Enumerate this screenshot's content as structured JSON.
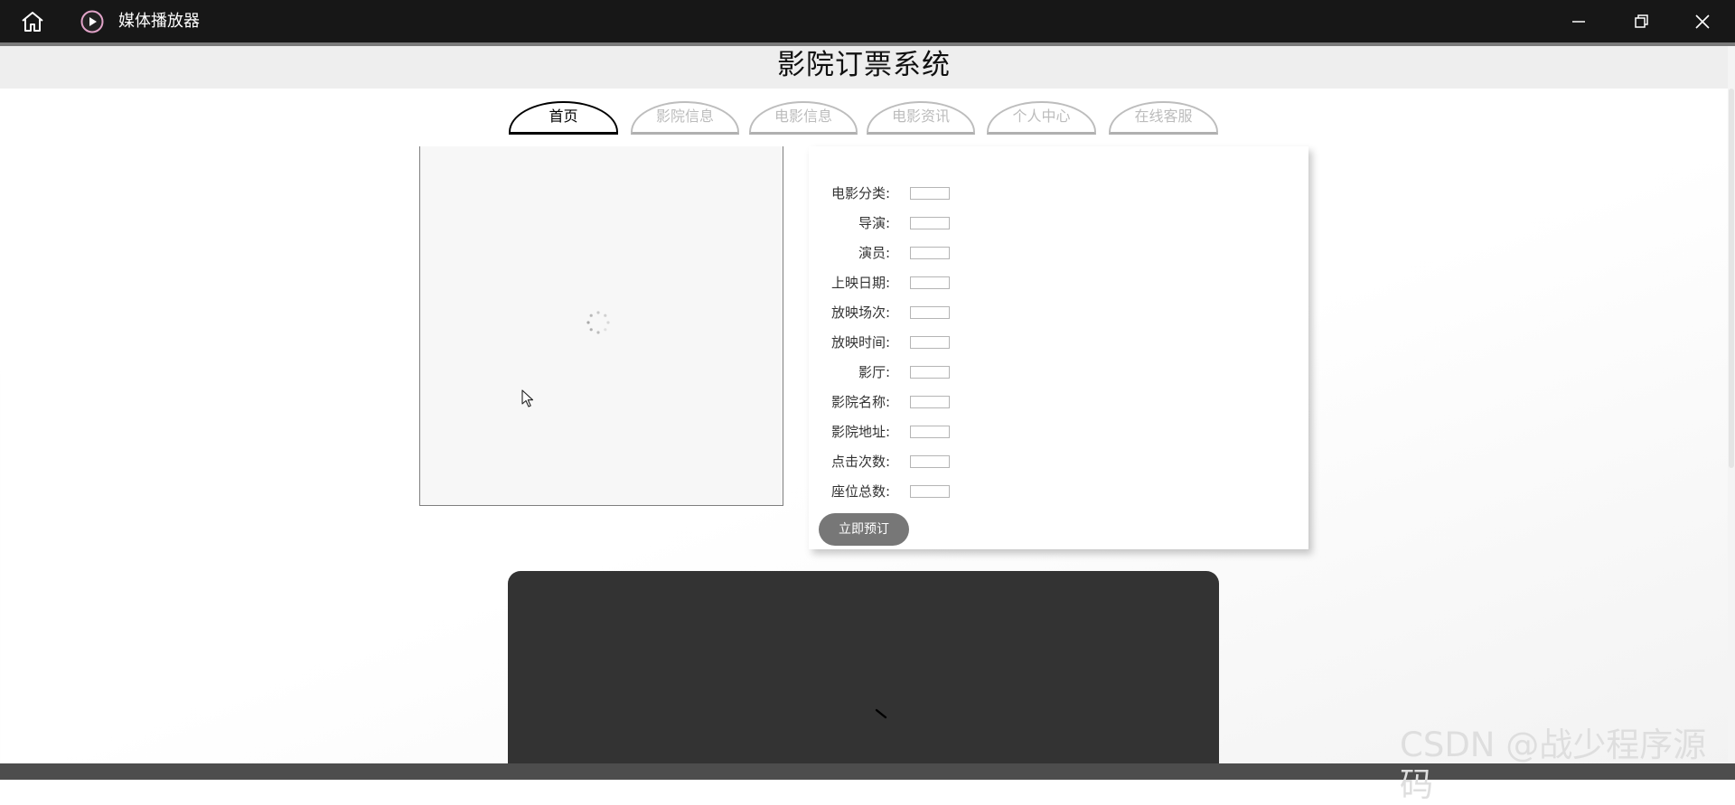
{
  "window": {
    "title": "媒体播放器",
    "icons": {
      "home": "home-icon",
      "app": "play-circle-icon",
      "minimize": "minimize-icon",
      "maximize": "restore-icon",
      "close": "close-icon"
    }
  },
  "page": {
    "title": "影院订票系统"
  },
  "nav": {
    "tabs": [
      {
        "label": "首页",
        "active": true
      },
      {
        "label": "影院信息",
        "active": false
      },
      {
        "label": "电影信息",
        "active": false
      },
      {
        "label": "电影资讯",
        "active": false
      },
      {
        "label": "个人中心",
        "active": false
      },
      {
        "label": "在线客服",
        "active": false
      }
    ]
  },
  "movie": {
    "fields": [
      {
        "label": "电影分类:",
        "value": ""
      },
      {
        "label": "导演:",
        "value": ""
      },
      {
        "label": "演员:",
        "value": ""
      },
      {
        "label": "上映日期:",
        "value": ""
      },
      {
        "label": "放映场次:",
        "value": ""
      },
      {
        "label": "放映时间:",
        "value": ""
      },
      {
        "label": "影厅:",
        "value": ""
      },
      {
        "label": "影院名称:",
        "value": ""
      },
      {
        "label": "影院地址:",
        "value": ""
      },
      {
        "label": "点击次数:",
        "value": ""
      },
      {
        "label": "座位总数:",
        "value": ""
      }
    ],
    "book_button": "立即预订"
  },
  "watermark": "CSDN @战少程序源码",
  "colors": {
    "titlebar": "#171717",
    "header": "#eeeeee",
    "button": "#777777",
    "video": "#333333"
  }
}
